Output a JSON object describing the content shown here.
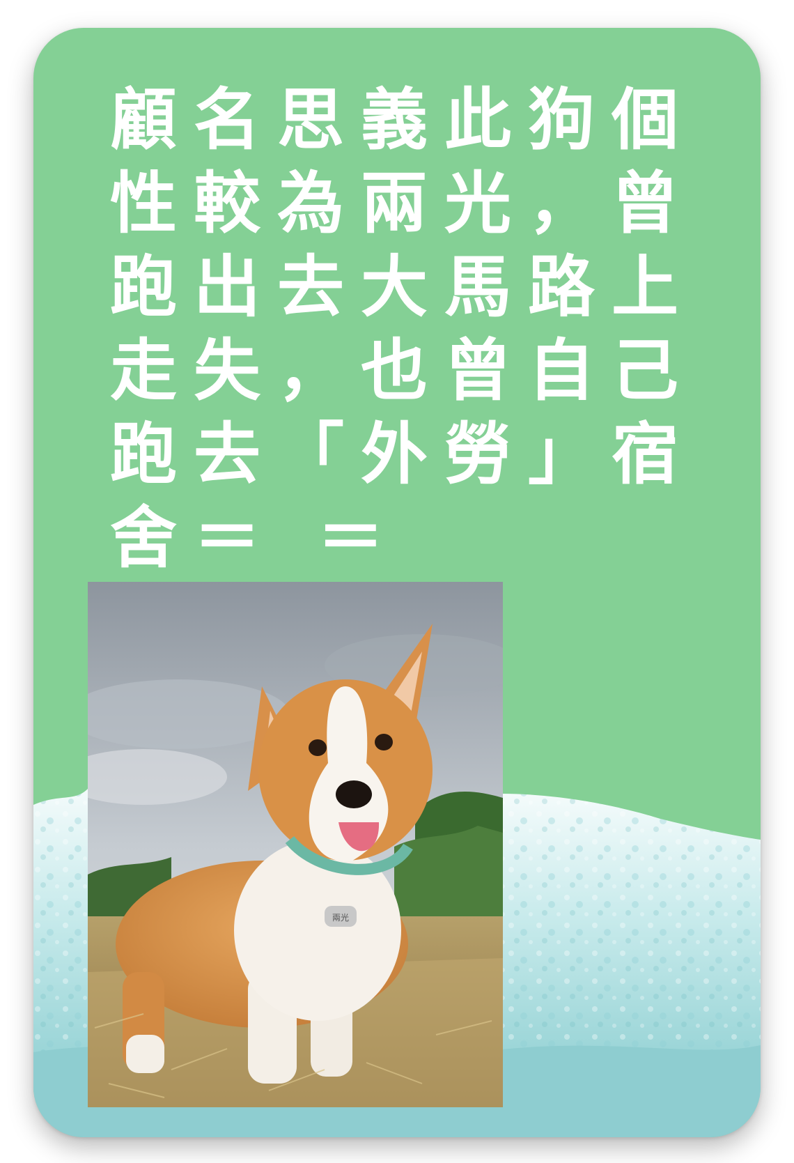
{
  "card": {
    "caption": "顧名思義此狗個性較為兩光，曾跑出去大馬路上走失，也曾自己跑去「外勞」宿舍＝ ＝",
    "background_color": "#84d095",
    "text_color": "#ffffff",
    "wave_color": "#a9dcdf"
  },
  "photo": {
    "subject": "corgi-dog",
    "tag_text": "兩光"
  }
}
